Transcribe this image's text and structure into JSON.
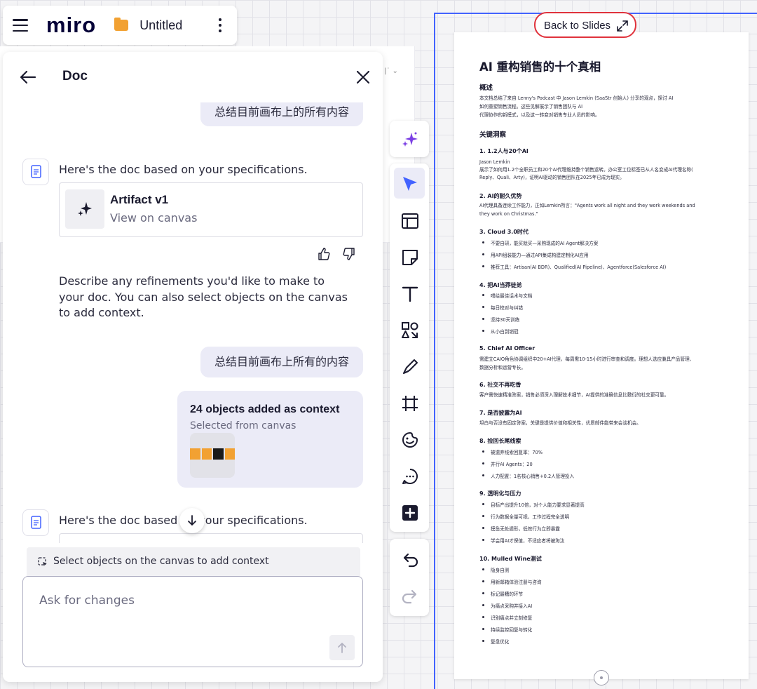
{
  "topbar": {
    "logo": "miro",
    "board_title": "Untitled"
  },
  "doc_panel": {
    "title": "Doc",
    "messages": {
      "user_partial": "总结目前画布上的所有内容",
      "ai_reply_1": "Here's the doc based on your specifications.",
      "artifact_name": "Artifact v1",
      "artifact_sub": "View on canvas",
      "refine": "Describe any refinements you'd like to make to your doc. You can also select objects on the canvas to add context.",
      "user_2": "总结目前画布上所有的内容",
      "context_title": "24 objects added as context",
      "context_sub": "Selected from canvas",
      "ai_reply_2": "Here's the doc based on your specifications."
    },
    "context_hint": "Select objects on the canvas to add context",
    "ask_placeholder": "Ask for changes"
  },
  "toolbar": {
    "tools": [
      "ai-sparkle",
      "select",
      "templates",
      "sticky-note",
      "text",
      "shapes",
      "pen",
      "frame",
      "stickers",
      "comment",
      "more"
    ],
    "active": "select",
    "history": [
      "undo",
      "redo"
    ]
  },
  "back_to_slides": "Back to Slides",
  "slide": {
    "title": "AI 重构销售的十个真相",
    "overview_h": "概述",
    "overview_1": "本文档总结了来自 Lenny's Podcast 中 Jason Lemkin (SaaStr 创始人) 分享的观点，探讨 AI",
    "overview_2": "如何重塑销售流程。这些见解展示了销售团队与 AI",
    "overview_3": "代理协作的新模式，以及这一转变对销售专业人员的影响。",
    "insights_h": "关键洞察",
    "s1_h": "1. 1.2人与20个AI",
    "s1_t1": "Jason Lemkin",
    "s1_t2": "展示了如何用1.2个全职员工和20个AI代理维持整个销售运转。办公室工位标签已从人名变成AI代理名称(",
    "s1_t3": "Reply、Quali、Arty)，证明AI驱动的销售团队在2025年已成为现实。",
    "s2_h": "2. AI的耐久优势",
    "s2_t1": "AI代理具备连续工作能力，正如Lemkin所言：\"Agents work all night and they work weekends and",
    "s2_t2": "they work on Christmas.\"",
    "s3_h": "3. Cloud 3.0时代",
    "s3_b": [
      "不要自研，能买就买—采购现成的AI Agent解决方案",
      "用API组装能力—通过API集成构建定制化AI应用",
      "推荐工具：Artisan(AI BDR)、Qualified(AI Pipeline)、Agentforce(Salesforce AI)"
    ],
    "s4_h": "4. 把AI当莽徒弟",
    "s4_b": [
      "喂给最佳话术与文档",
      "每日校对与纠错",
      "坚持30天训练",
      "从小白到销冠"
    ],
    "s5_h": "5. Chief AI Officer",
    "s5_t1": "需建立CAIO角色协调组织中20+AI代理，每周需10-15小时进行审查和调度。理想人选应兼具产品管理、",
    "s5_t2": "数据分析和运营专长。",
    "s6_h": "6. 社交不再吃香",
    "s6_t1": "客户需快速精准答案，销售必须深入理解技术细节，AI提供的准确信息比敷衍的社交更可靠。",
    "s7_h": "7. 是否披露为AI",
    "s7_t1": "坦白与否没有固定答案，关键是提供价值和相关性，优质邮件能带来会谈机会。",
    "s8_h": "8. 捡回长尾线索",
    "s8_b": [
      "被遗弃线索回复率：70%",
      "并行AI Agents：20",
      "人力配置：1名核心销售+0.2人管理投入"
    ],
    "s9_h": "9. 透明化与压力",
    "s9_b": [
      "目标产出提升10倍，对个人能力要求显著提高",
      "行为数据全量可视，工作过程完全透明",
      "摸鱼无处遁形，低效行为立即暴露",
      "学会用AI才保值，不适应者将被淘汰"
    ],
    "s10_h": "10. Mulled Wine测试",
    "s10_b": [
      "隐身自测",
      "用新邮箱体验注册与咨询",
      "标记最糟的环节",
      "为痛点采购并接入AI",
      "识别痛点并立刻修复",
      "持续监控回复与转化",
      "复盘优化"
    ]
  },
  "colors": {
    "accent": "#4262ff",
    "highlight": "#e0323c",
    "folder": "#f2a132"
  }
}
